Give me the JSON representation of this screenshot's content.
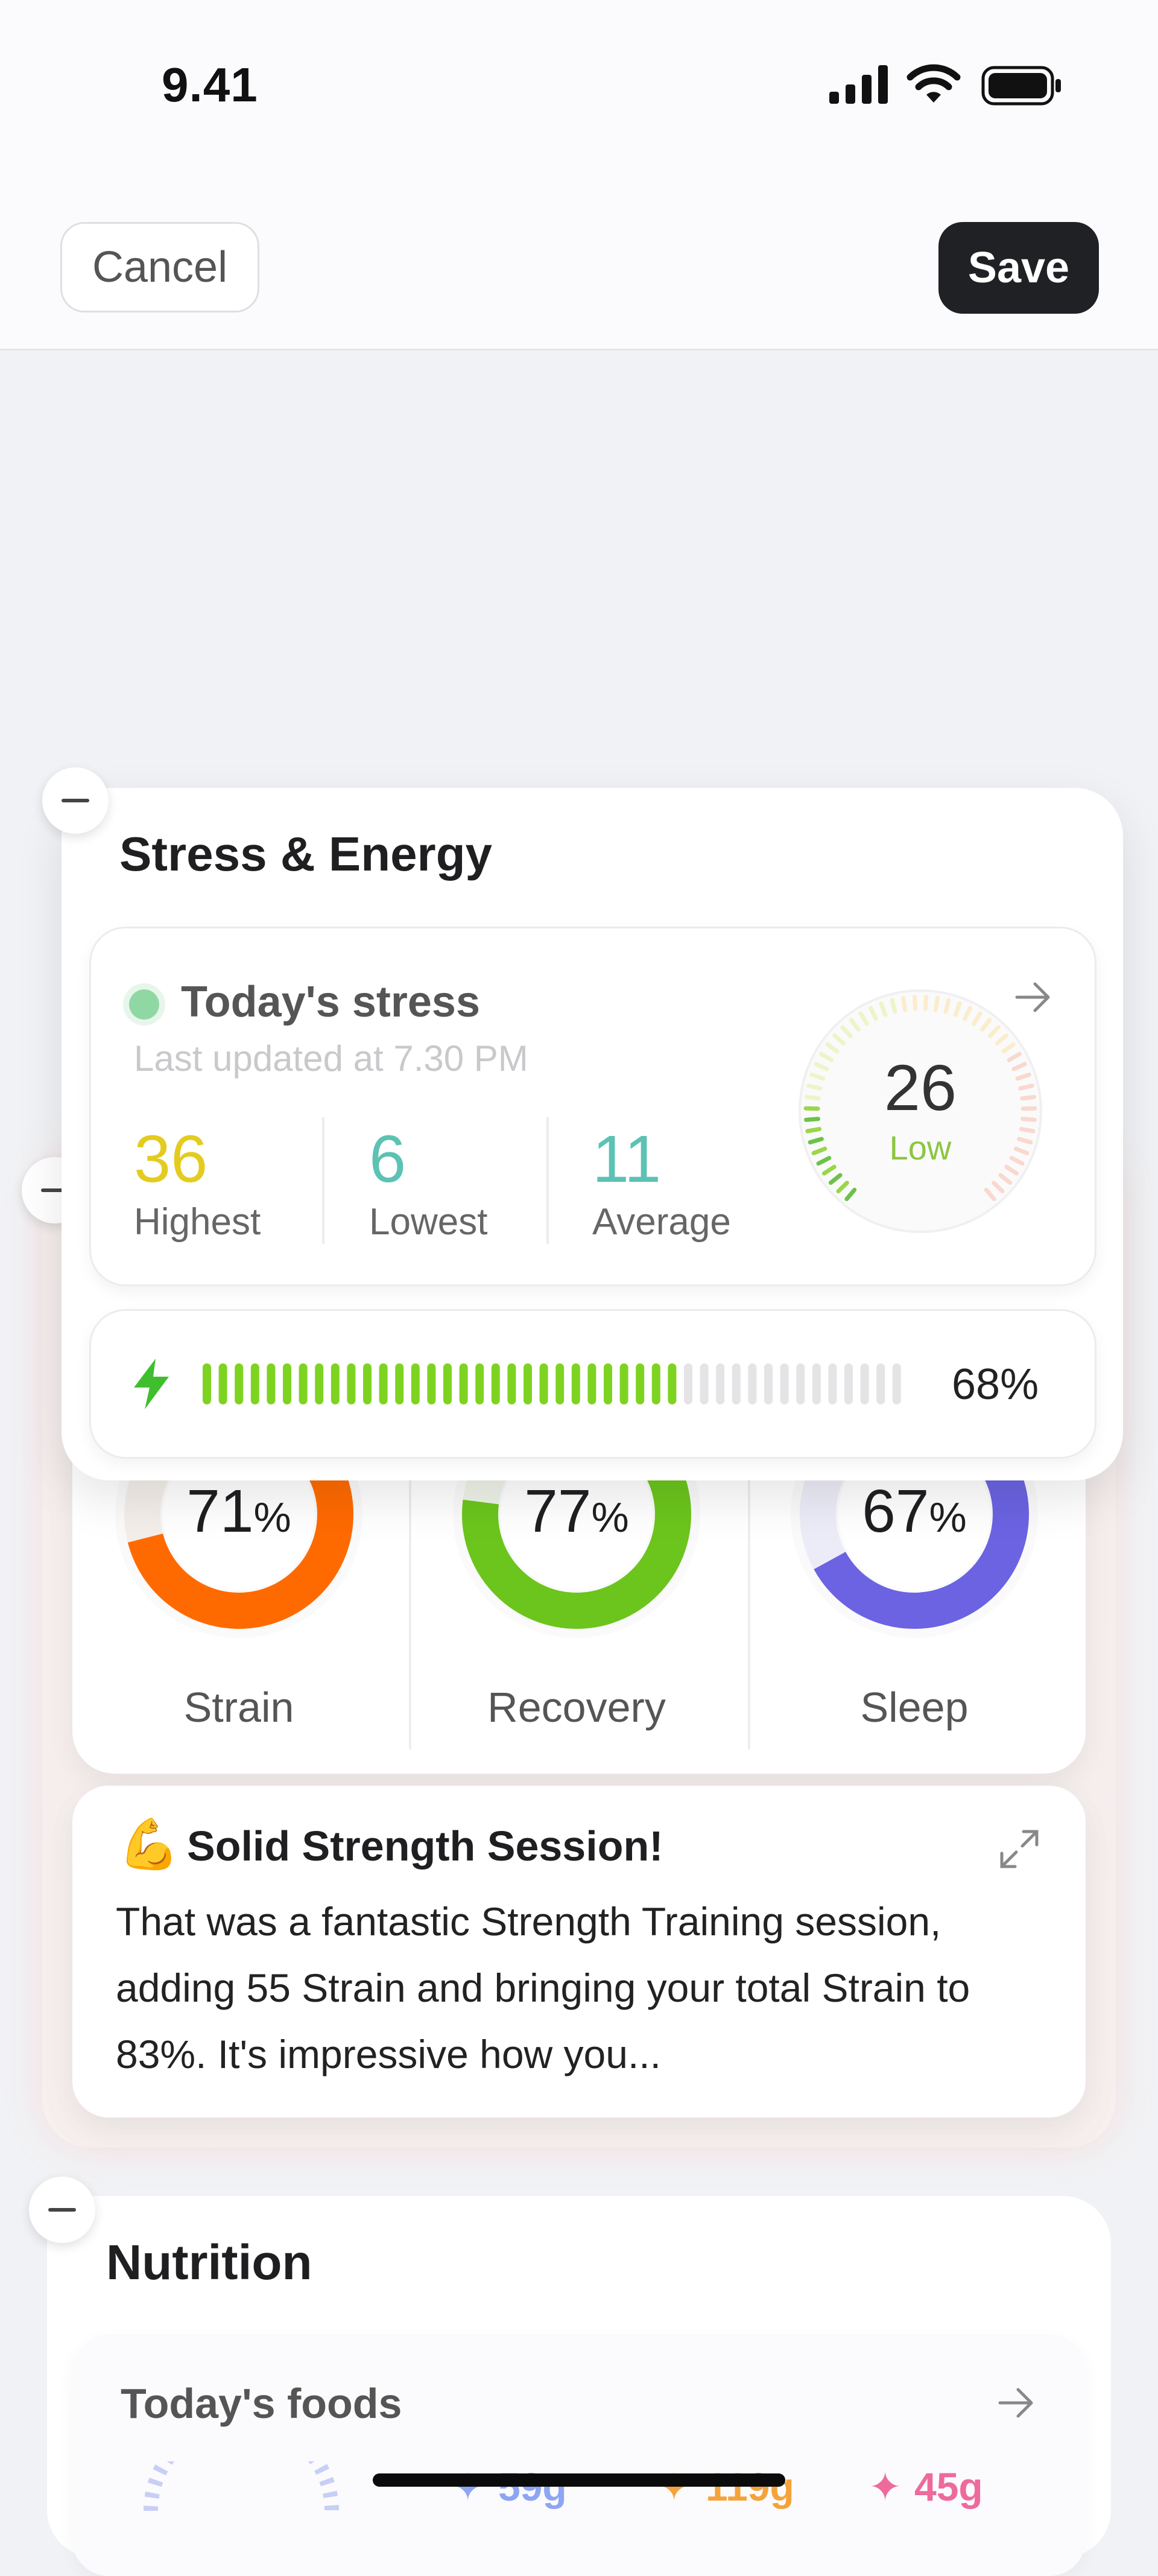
{
  "status_bar": {
    "time": "9.41"
  },
  "header": {
    "cancel_label": "Cancel",
    "save_label": "Save"
  },
  "whoop_card": {
    "rings": [
      {
        "value": "71",
        "unit": "%",
        "label": "Strain",
        "fraction": 0.71,
        "color": "#ff6a00"
      },
      {
        "value": "77",
        "unit": "%",
        "label": "Recovery",
        "fraction": 0.77,
        "color": "#6cc51c"
      },
      {
        "value": "67",
        "unit": "%",
        "label": "Sleep",
        "fraction": 0.67,
        "color": "#6b63e2"
      }
    ],
    "insight_emoji": "💪",
    "insight_title": "Solid Strength Session!",
    "insight_body": "That was a fantastic Strength Training session, adding 55 Strain and bringing your total Strain to 83%. It's impressive how you..."
  },
  "stress_energy": {
    "title": "Stress & Energy",
    "today_label": "Today's stress",
    "last_updated": "Last updated at 7.30 PM",
    "stats": [
      {
        "value": "36",
        "label": "Highest",
        "color": "#e3cc1f"
      },
      {
        "value": "6",
        "label": "Lowest",
        "color": "#5cc2b4"
      },
      {
        "value": "11",
        "label": "Average",
        "color": "#5cc2b4"
      }
    ],
    "gauge_value": "26",
    "gauge_label": "Low",
    "energy_percent": "68%",
    "energy_fraction": 0.68
  },
  "nutrition": {
    "title": "Nutrition",
    "foods_label": "Today's foods",
    "macros": [
      {
        "value": "59g",
        "color": "#8ea4f5"
      },
      {
        "value": "119g",
        "color": "#f4a33a"
      },
      {
        "value": "45g",
        "color": "#ee6a9c"
      }
    ]
  }
}
